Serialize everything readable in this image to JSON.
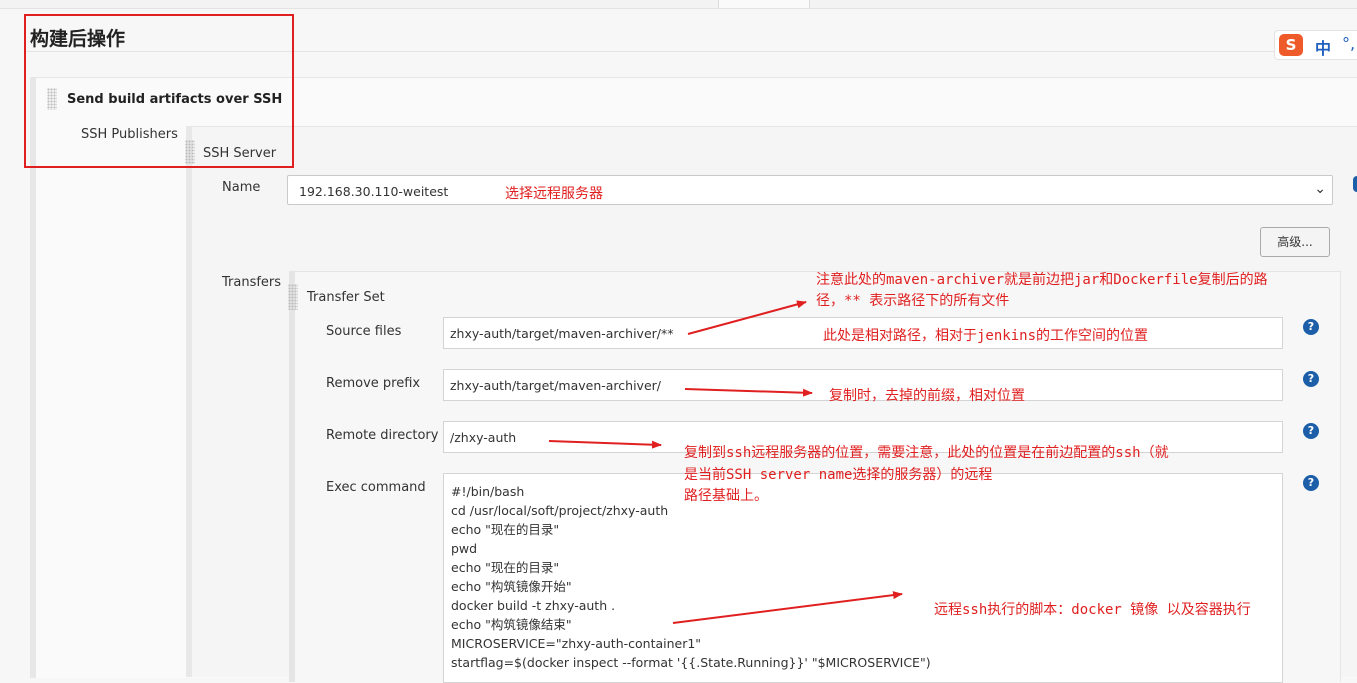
{
  "section": {
    "title": "构建后操作"
  },
  "step": {
    "title": "Send build artifacts over SSH"
  },
  "labels": {
    "ssh_publishers": "SSH Publishers",
    "ssh_server": "SSH Server",
    "name": "Name",
    "transfers": "Transfers",
    "transfer_set": "Transfer Set",
    "source_files": "Source files",
    "remove_prefix": "Remove prefix",
    "remote_directory": "Remote directory",
    "exec_command": "Exec command"
  },
  "server": {
    "selected": "192.168.30.110-weitest"
  },
  "buttons": {
    "advanced": "高级..."
  },
  "fields": {
    "source_files": "zhxy-auth/target/maven-archiver/**",
    "remove_prefix": "zhxy-auth/target/maven-archiver/",
    "remote_directory": "/zhxy-auth",
    "exec_command": "#!/bin/bash\ncd /usr/local/soft/project/zhxy-auth\necho \"现在的目录\"\npwd\necho \"现在的目录\"\necho \"构筑镜像开始\"\ndocker build -t zhxy-auth .\necho \"构筑镜像结束\"\nMICROSERVICE=\"zhxy-auth-container1\"\nstartflag=$(docker inspect --format '{{.State.Running}}' \"$MICROSERVICE\")"
  },
  "help_glyph": "?",
  "ime": {
    "logo": "S",
    "lang": "中",
    "punct": "°,"
  },
  "annotations": {
    "select_server": "选择远程服务器",
    "source_note_1": "注意此处的maven-archiver就是前边把jar和Dockerfile复制后的路",
    "source_note_2": "径，** 表示路径下的所有文件",
    "relative_note": "此处是相对路径，相对于jenkins的工作空间的位置",
    "prefix_note": "复制时，去掉的前缀，相对位置",
    "remote_note_1": "复制到ssh远程服务器的位置，需要注意，此处的位置是在前边配置的ssh（就",
    "remote_note_2": "是当前SSH server name选择的服务器）的远程",
    "remote_note_3": "路径基础上。",
    "exec_note": "远程ssh执行的脚本：docker 镜像 以及容器执行"
  },
  "colors": {
    "annotation": "#e02020",
    "help_icon": "#1c5fa8",
    "ime_logo": "#ef5a2a"
  }
}
